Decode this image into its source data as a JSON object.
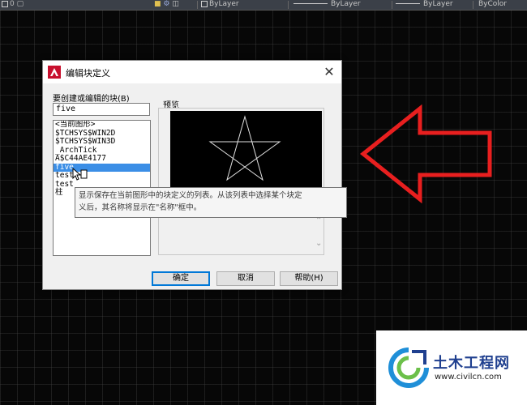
{
  "toolbar": {
    "layer1": "ByLayer",
    "linetype": "ByLayer",
    "lineweight": "ByLayer",
    "plotstyle": "ByColor"
  },
  "dialog": {
    "title": "编辑块定义",
    "close_glyph": "✕",
    "name_label": "要创建或编辑的块(B)",
    "name_value": "five",
    "list_items": [
      "<当前图形>",
      "$TCHSYS$WIN2D",
      "$TCHSYS$WIN3D",
      "_ArchTick",
      "A$C44AE4177",
      "five",
      "test",
      "test",
      "柱"
    ],
    "selected_index": 5,
    "preview_label": "预览",
    "ok_label": "确定",
    "cancel_label": "取消",
    "help_label": "帮助(H)"
  },
  "tooltip": {
    "line1": "显示保存在当前图形中的块定义的列表。从该列表中选择某个块定",
    "line2": "义后，其名称将显示在\"名称\"框中。"
  },
  "watermark": {
    "name": "土木工程网",
    "url": "www.civilcn.com"
  },
  "colors": {
    "arrow": "#e81f1f",
    "selection": "#3b8ee6",
    "canvas": "#070707"
  }
}
